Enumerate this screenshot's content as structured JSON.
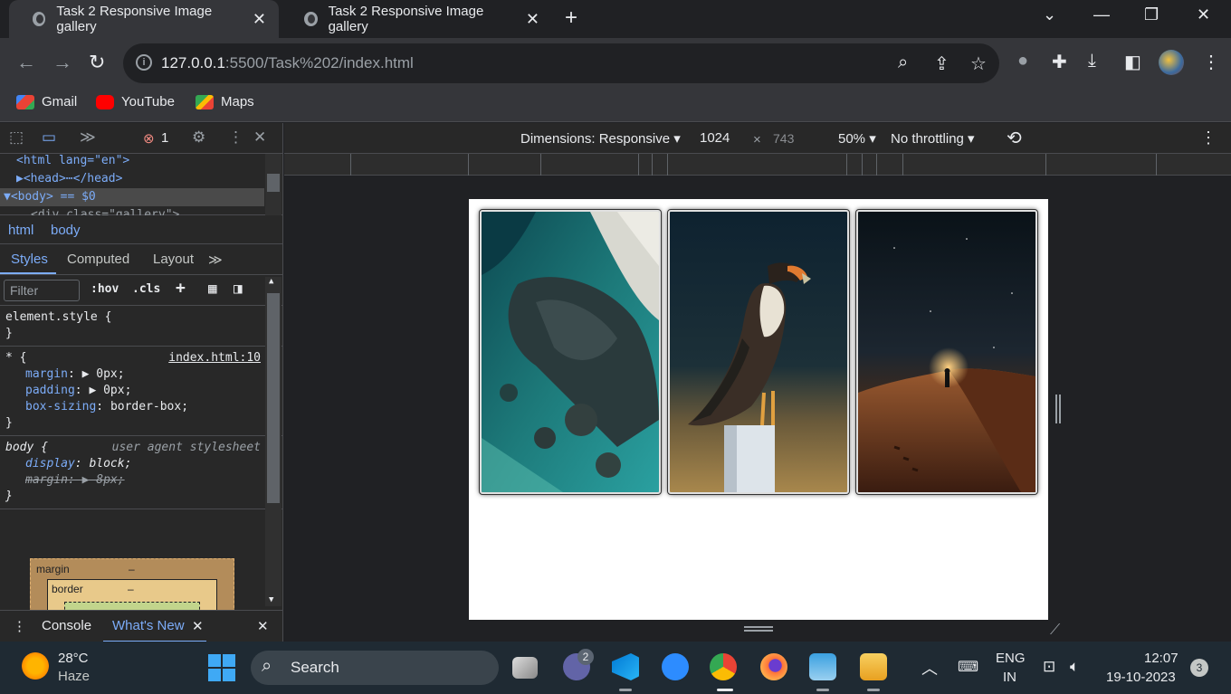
{
  "browser": {
    "tabs": [
      {
        "title": "Task 2 Responsive Image gallery",
        "close": "✕"
      },
      {
        "title": "Task 2 Responsive Image gallery",
        "close": "✕"
      }
    ],
    "new_tab": "+",
    "window_controls": {
      "minimize": "—",
      "maximize": "❐",
      "close": "✕",
      "dropdown": "⌄"
    },
    "url_host": "127.0.0.1",
    "url_rest": ":5500/Task%202/index.html",
    "bookmarks": [
      {
        "label": "Gmail",
        "color": "#ea4335"
      },
      {
        "label": "YouTube",
        "color": "#ff0000"
      },
      {
        "label": "Maps",
        "color": "#34a853"
      }
    ]
  },
  "devtools": {
    "error_count": "1",
    "dom_lines": [
      "<html lang=\"en\">",
      "▶<head>⋯</head>",
      "▼<body> == $0",
      "<div class=\"gallery\">"
    ],
    "breadcrumbs": [
      "html",
      "body"
    ],
    "subtabs": [
      "Styles",
      "Computed",
      "Layout",
      "≫"
    ],
    "filter_placeholder": "Filter",
    "hov": ":hov",
    "cls": ".cls",
    "rules": {
      "element_style": "element.style {",
      "close": "}",
      "star_selector": "* {",
      "star_source": "index.html:10",
      "star_props": [
        {
          "name": "margin",
          "value": "▶ 0px;"
        },
        {
          "name": "padding",
          "value": "▶ 0px;"
        },
        {
          "name": "box-sizing",
          "value": "border-box;"
        }
      ],
      "body_selector": "body {",
      "body_source": "user agent stylesheet",
      "body_props": [
        {
          "name": "display",
          "value": "block;"
        },
        {
          "name": "margin",
          "value": "▶ 8px;"
        }
      ]
    },
    "boxmodel": {
      "margin_label": "margin",
      "border_label": "border",
      "dash": "–"
    },
    "drawer": {
      "console": "Console",
      "whats_new": "What's New"
    }
  },
  "device_toolbar": {
    "dimensions": "Dimensions: Responsive ▾",
    "width": "1024",
    "times": "×",
    "height": "743",
    "zoom": "50% ▾",
    "throttle": "No throttling ▾"
  },
  "gallery": {
    "images": [
      "ocean-rocks",
      "caracara-bird",
      "desert-night"
    ]
  },
  "taskbar": {
    "weather_temp": "28°C",
    "weather_desc": "Haze",
    "search": "Search",
    "teams_badge": "2",
    "lang_line1": "ENG",
    "lang_line2": "IN",
    "time": "12:07",
    "date": "19-10-2023",
    "notifications": "3"
  }
}
